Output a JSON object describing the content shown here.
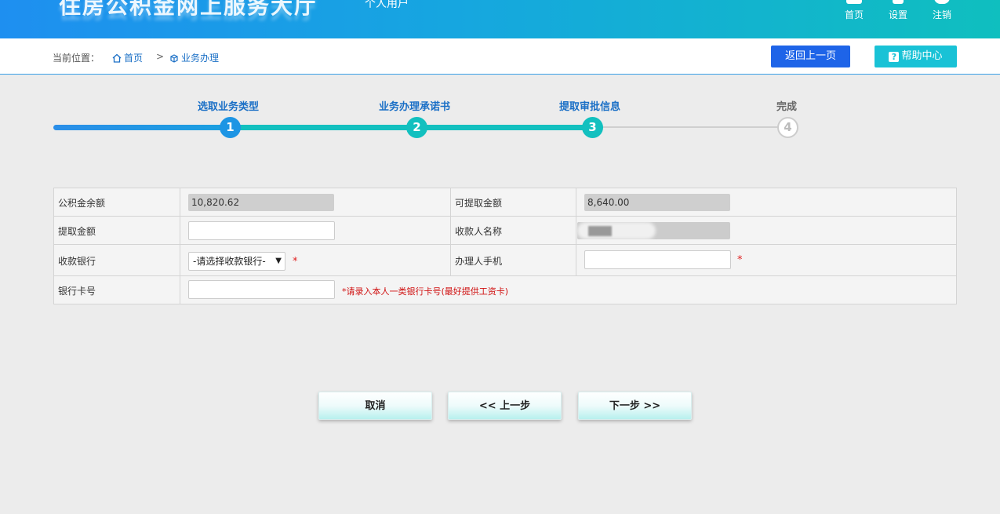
{
  "header": {
    "logo_title": "住房公积金网上服务大厅",
    "logo_subtitle": "个人用户",
    "nav": [
      {
        "label": "首页",
        "icon": "home-icon"
      },
      {
        "label": "设置",
        "icon": "settings-icon"
      },
      {
        "label": "注销",
        "icon": "logout-icon"
      }
    ]
  },
  "breadcrumb": {
    "label": "当前位置：",
    "home": "首页",
    "separator": ">",
    "current": "业务办理"
  },
  "actions": {
    "back_label": "返回上一页",
    "help_label": "帮助中心",
    "help_glyph": "?"
  },
  "steps": [
    {
      "number": "1",
      "label": "选取业务类型"
    },
    {
      "number": "2",
      "label": "业务办理承诺书"
    },
    {
      "number": "3",
      "label": "提取审批信息"
    },
    {
      "number": "4",
      "label": "完成"
    }
  ],
  "form": {
    "balance_label": "公积金余额",
    "balance_value": "10,820.62",
    "withdrawable_label": "可提取金额",
    "withdrawable_value": "8,640.00",
    "amount_label": "提取金额",
    "amount_value": "",
    "payee_label": "收款人名称",
    "bank_label": "收款银行",
    "bank_select": "-请选择收款银行-",
    "required_mark": "*",
    "phone_label": "办理人手机",
    "phone_value": "",
    "card_label": "银行卡号",
    "card_value": "",
    "card_hint": "*请录入本人一类银行卡号(最好提供工资卡)"
  },
  "buttons": {
    "cancel": "取消",
    "prev": "<< 上一步",
    "next": "下一步 >>"
  },
  "colors": {
    "header_start": "#1e8ff0",
    "header_end": "#0fbfbf",
    "back_button": "#1e64e8",
    "help_button": "#19c2d6",
    "step_active": "#12c0bf",
    "link": "#1a6fc6",
    "required": "#e02020"
  }
}
